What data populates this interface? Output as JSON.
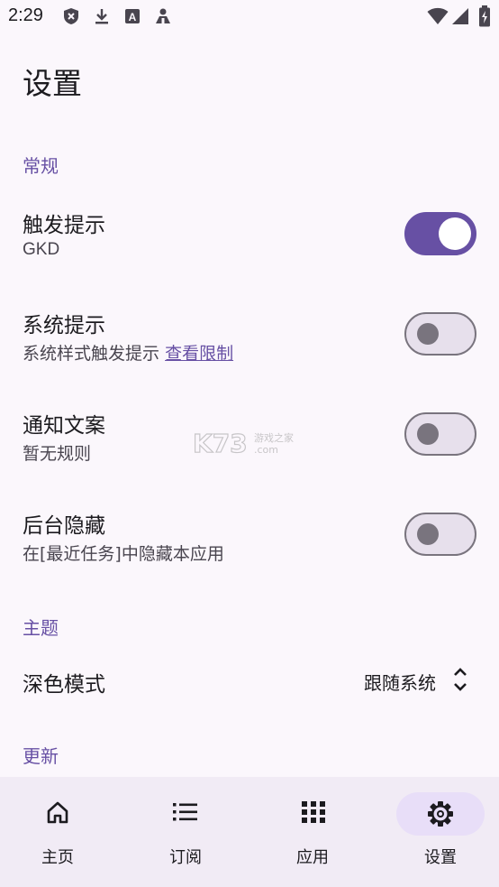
{
  "status_bar": {
    "time": "2:29",
    "icons": [
      "shield-x-icon",
      "download-icon",
      "text-a-icon",
      "person-icon",
      "wifi-icon",
      "signal-icon",
      "battery-charging-icon"
    ]
  },
  "page": {
    "title": "设置"
  },
  "sections": {
    "general": {
      "header": "常规",
      "items": [
        {
          "title": "触发提示",
          "subtitle": "GKD",
          "toggle": true
        },
        {
          "title": "系统提示",
          "subtitle": "系统样式触发提示",
          "link": "查看限制",
          "toggle": false
        },
        {
          "title": "通知文案",
          "subtitle": "暂无规则",
          "toggle": false
        },
        {
          "title": "后台隐藏",
          "subtitle": "在[最近任务]中隐藏本应用",
          "toggle": false
        }
      ]
    },
    "theme": {
      "header": "主题",
      "dark_mode": {
        "title": "深色模式",
        "value": "跟随系统"
      }
    },
    "update": {
      "header": "更新"
    }
  },
  "bottom_nav": {
    "items": [
      {
        "label": "主页",
        "icon": "home-icon",
        "selected": false
      },
      {
        "label": "订阅",
        "icon": "list-icon",
        "selected": false
      },
      {
        "label": "应用",
        "icon": "apps-grid-icon",
        "selected": false
      },
      {
        "label": "设置",
        "icon": "settings-gear-icon",
        "selected": true
      }
    ]
  },
  "colors": {
    "accent": "#6750a4",
    "background": "#fbf7fc",
    "nav_background": "#f1ebf5",
    "nav_indicator": "#e8def8"
  }
}
